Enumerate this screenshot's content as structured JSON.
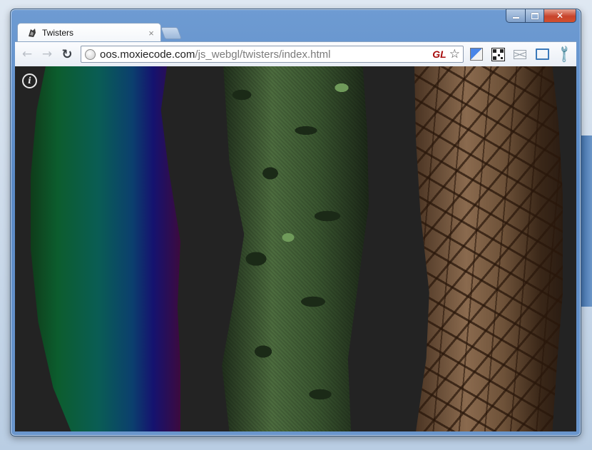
{
  "window": {
    "minimize_icon": "minimize-icon",
    "maximize_icon": "maximize-icon",
    "close_glyph": "✕"
  },
  "tab": {
    "title": "Twisters",
    "favicon": "twister-favicon-icon",
    "close_glyph": "×"
  },
  "toolbar": {
    "back_glyph": "←",
    "forward_glyph": "→",
    "reload_glyph": "↻",
    "url_host": "oos.moxiecode.com",
    "url_path": "/js_webgl/twisters/index.html",
    "gl_badge": "GL",
    "star_glyph": "☆",
    "wrench_glyph": "🔧"
  },
  "content": {
    "info_glyph": "i",
    "twisters": [
      {
        "name": "rainbow-gradient-twister"
      },
      {
        "name": "camouflage-twister"
      },
      {
        "name": "cracked-stone-twister"
      }
    ]
  }
}
